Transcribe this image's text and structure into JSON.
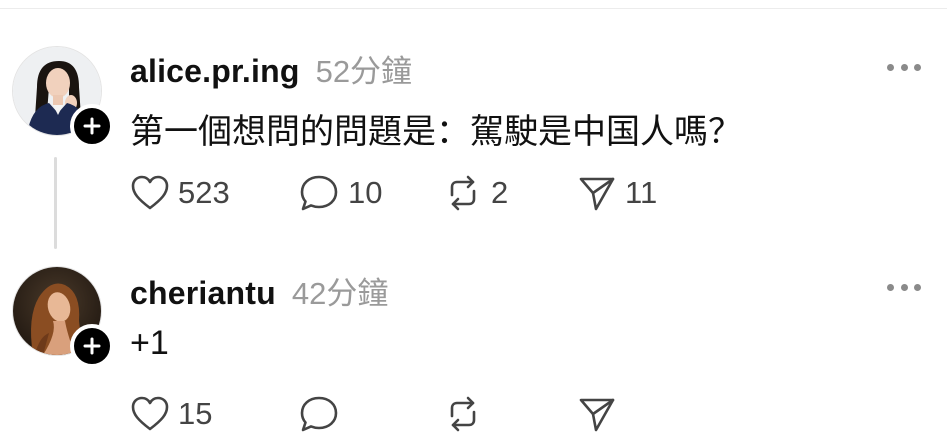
{
  "posts": [
    {
      "username": "alice.pr.ing",
      "timestamp": "52分鐘",
      "text": "第一個想問的問題是：駕駛是中国人嗎？",
      "likes": "523",
      "replies": "10",
      "reposts": "2",
      "shares": "11"
    },
    {
      "username": "cheriantu",
      "timestamp": "42分鐘",
      "text": "+1",
      "likes": "15",
      "replies": "",
      "reposts": "",
      "shares": ""
    }
  ],
  "icons": {
    "like": "heart-icon",
    "reply": "speech-bubble-icon",
    "repost": "repost-arrows-icon",
    "share": "paper-plane-icon",
    "more": "more-dots-icon",
    "follow": "plus-icon"
  },
  "colors": {
    "text": "#111111",
    "muted": "#9a9a9a",
    "icon": "#444444",
    "badge": "#000000"
  }
}
